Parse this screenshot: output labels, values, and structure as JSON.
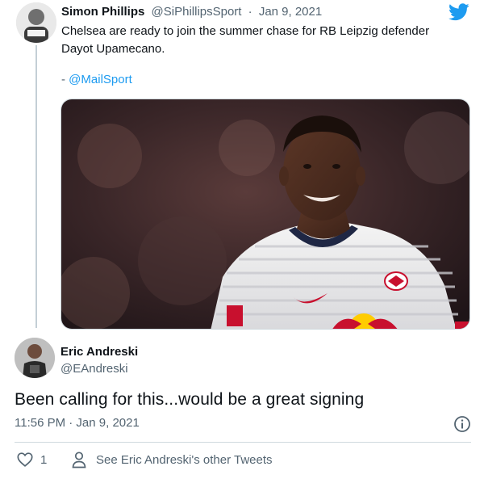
{
  "parent_tweet": {
    "display_name": "Simon Phillips",
    "handle": "@SiPhillipsSport",
    "date": "Jan 9, 2021",
    "text_line1": "Chelsea are ready to join the summer chase for RB Leipzig defender",
    "text_line2": "Dayot Upamecano.",
    "source_prefix": "- ",
    "source_handle": "@MailSport"
  },
  "reply_tweet": {
    "display_name": "Eric Andreski",
    "handle": "@EAndreski",
    "text": "Been calling for this...would be a great signing",
    "timestamp": "11:56 PM · Jan 9, 2021",
    "like_count": "1",
    "see_more_label": "See Eric Andreski's other Tweets"
  },
  "icons": {
    "brand": "twitter-bird-icon",
    "info": "info-icon",
    "like": "heart-icon",
    "profile": "person-icon"
  },
  "colors": {
    "accent": "#1d9bf0",
    "text_primary": "#0f1419",
    "text_secondary": "#536471",
    "divider": "#cfd9de"
  }
}
